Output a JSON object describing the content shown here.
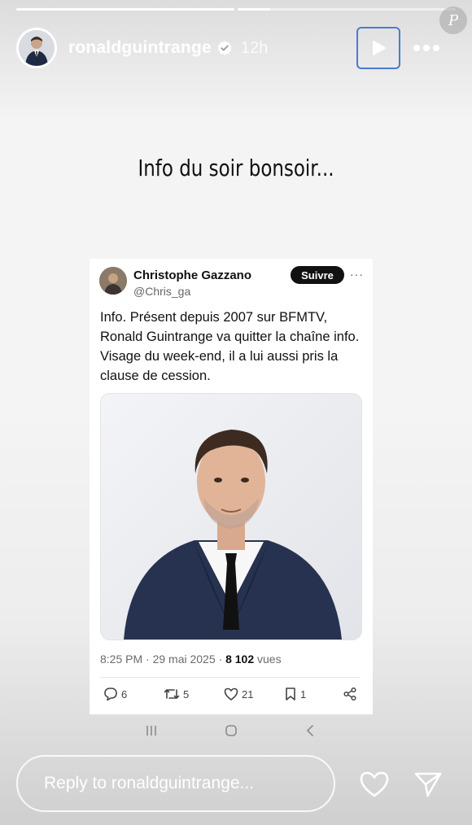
{
  "story": {
    "progress": [
      1.0,
      0.15
    ],
    "username": "ronaldguintrange",
    "time": "12h",
    "text": "Info du soir bonsoir...",
    "watermark": "P"
  },
  "tweet": {
    "name": "Christophe Gazzano",
    "handle": "@Chris_ga",
    "follow_label": "Suivre",
    "more": "···",
    "text": "Info. Présent depuis 2007 sur BFMTV, Ronald Guintrange va quitter la chaîne info. Visage du week-end, il a lui aussi pris la clause de cession.",
    "meta_time": "8:25 PM · 29 mai 2025 · ",
    "views": "8 102",
    "views_label": " vues",
    "replies": "6",
    "retweets": "5",
    "likes": "21",
    "bookmarks": "1"
  },
  "reply": {
    "placeholder": "Reply to ronaldguintrange..."
  },
  "icons": {
    "verified": "verified-badge-icon",
    "play": "play-icon",
    "more": "more-icon",
    "heart": "heart-icon",
    "send": "send-icon"
  }
}
